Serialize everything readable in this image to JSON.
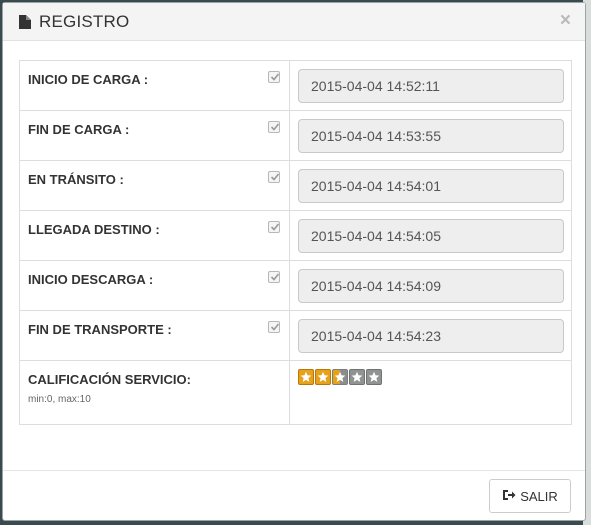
{
  "modal": {
    "title": "REGISTRO",
    "close_glyph": "×"
  },
  "rows": [
    {
      "label": "INICIO DE CARGA :",
      "checked": true,
      "value": "2015-04-04 14:52:11"
    },
    {
      "label": "FIN DE CARGA :",
      "checked": true,
      "value": "2015-04-04 14:53:55"
    },
    {
      "label": "EN TRÁNSITO :",
      "checked": true,
      "value": "2015-04-04 14:54:01"
    },
    {
      "label": "LLEGADA DESTINO :",
      "checked": true,
      "value": "2015-04-04 14:54:05"
    },
    {
      "label": "INICIO DESCARGA :",
      "checked": true,
      "value": "2015-04-04 14:54:09"
    },
    {
      "label": "FIN DE TRANSPORTE :",
      "checked": true,
      "value": "2015-04-04 14:54:23"
    }
  ],
  "rating": {
    "label": "CALIFICACIÓN SERVICIO:",
    "range_text": "min:0, max:10",
    "stars_value": 2.5,
    "stars_max": 5
  },
  "footer": {
    "exit_label": "SALIR"
  },
  "colors": {
    "star_on": "#e6a21a",
    "star_off": "#8f9492",
    "input_bg": "#eeeeee"
  },
  "icons": {
    "title_icon": "document-icon",
    "exit_icon": "sign-out-icon",
    "check_icon": "checkmark-icon"
  }
}
